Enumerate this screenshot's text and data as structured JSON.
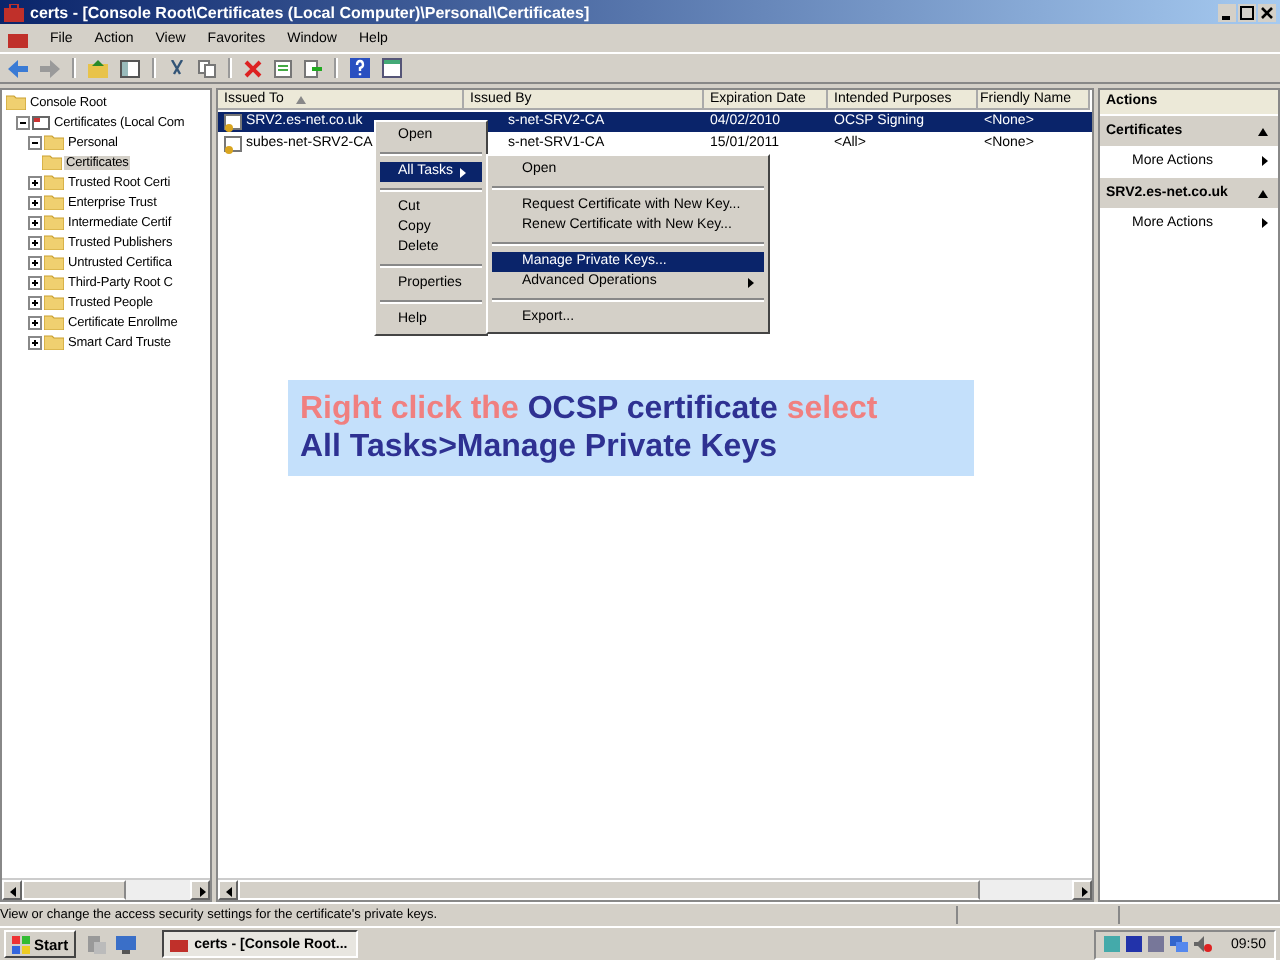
{
  "window": {
    "title": "certs - [Console Root\\Certificates (Local Computer)\\Personal\\Certificates]"
  },
  "menu": [
    "File",
    "Action",
    "View",
    "Favorites",
    "Window",
    "Help"
  ],
  "tree": [
    {
      "label": "Console Root",
      "selected": false,
      "children": [
        {
          "label": "Certificates (Local Com",
          "selected": false,
          "expanded": true,
          "children": [
            {
              "label": "Personal",
              "selected": false,
              "expanded": true,
              "children": [
                {
                  "label": "Certificates",
                  "selected": true
                }
              ]
            },
            {
              "label": "Trusted Root Certi",
              "selected": false,
              "expanded": false
            },
            {
              "label": "Enterprise Trust",
              "selected": false,
              "expanded": false
            },
            {
              "label": "Intermediate Certif",
              "selected": false,
              "expanded": false
            },
            {
              "label": "Trusted Publishers",
              "selected": false,
              "expanded": false
            },
            {
              "label": "Untrusted Certifica",
              "selected": false,
              "expanded": false
            },
            {
              "label": "Third-Party Root C",
              "selected": false,
              "expanded": false
            },
            {
              "label": "Trusted People",
              "selected": false,
              "expanded": false
            },
            {
              "label": "Certificate Enrollme",
              "selected": false,
              "expanded": false
            },
            {
              "label": "Smart Card Truste",
              "selected": false,
              "expanded": false
            }
          ]
        }
      ]
    }
  ],
  "table": {
    "columns": [
      {
        "label": "Issued To",
        "sorted": true
      },
      {
        "label": "Issued By",
        "sorted": false
      },
      {
        "label": "Expiration Date",
        "sorted": false
      },
      {
        "label": "Intended Purposes",
        "sorted": false
      },
      {
        "label": "Friendly Name",
        "sorted": false
      }
    ],
    "rows": [
      {
        "selected": true,
        "cells": [
          "SRV2.es-net.co.uk",
          "s-net-SRV2-CA",
          "04/02/2010",
          "OCSP Signing",
          "<None>"
        ]
      },
      {
        "selected": false,
        "cells": [
          "subes-net-SRV2-CA",
          "s-net-SRV1-CA",
          "15/01/2011",
          "<All>",
          "<None>"
        ]
      }
    ]
  },
  "context_menu": {
    "groups": [
      {
        "items": [
          {
            "label": "Open",
            "selected": false,
            "submenu": false
          }
        ]
      },
      {
        "items": [
          {
            "label": "All Tasks",
            "selected": true,
            "submenu": true
          }
        ]
      },
      {
        "items": [
          {
            "label": "Cut",
            "selected": false,
            "submenu": false
          },
          {
            "label": "Copy",
            "selected": false,
            "submenu": false
          },
          {
            "label": "Delete",
            "selected": false,
            "submenu": false
          }
        ]
      },
      {
        "items": [
          {
            "label": "Properties",
            "selected": false,
            "submenu": false
          }
        ]
      },
      {
        "items": [
          {
            "label": "Help",
            "selected": false,
            "submenu": false
          }
        ]
      }
    ]
  },
  "submenu": {
    "groups": [
      {
        "items": [
          {
            "label": "Open",
            "selected": false,
            "submenu": false
          }
        ]
      },
      {
        "items": [
          {
            "label": "Request Certificate with New Key...",
            "selected": false,
            "submenu": false
          },
          {
            "label": "Renew Certificate with New Key...",
            "selected": false,
            "submenu": false
          }
        ]
      },
      {
        "items": [
          {
            "label": "Manage Private Keys...",
            "selected": true,
            "submenu": false
          },
          {
            "label": "Advanced Operations",
            "selected": false,
            "submenu": true
          }
        ]
      },
      {
        "items": [
          {
            "label": "Export...",
            "selected": false,
            "submenu": false
          }
        ]
      }
    ]
  },
  "actions": {
    "title": "Actions",
    "sections": [
      {
        "title": "Certificates",
        "items": [
          "More Actions"
        ]
      },
      {
        "title": "SRV2.es-net.co.uk",
        "items": [
          "More Actions"
        ]
      }
    ]
  },
  "caption": {
    "lines": [
      [
        {
          "text": "Right click the",
          "color": "#f08080"
        },
        {
          "text": "OCSP certificate",
          "color": "#2e3192"
        },
        {
          "text": "select",
          "color": "#f08080"
        }
      ],
      [
        {
          "text": "All Tasks>Manage Private Keys",
          "color": "#2e3192"
        }
      ]
    ]
  },
  "status_bar": "View or change the access security settings for the certificate's private keys.",
  "taskbar": {
    "start": "Start",
    "task": "certs - [Console Root...",
    "clock": "09:50"
  }
}
